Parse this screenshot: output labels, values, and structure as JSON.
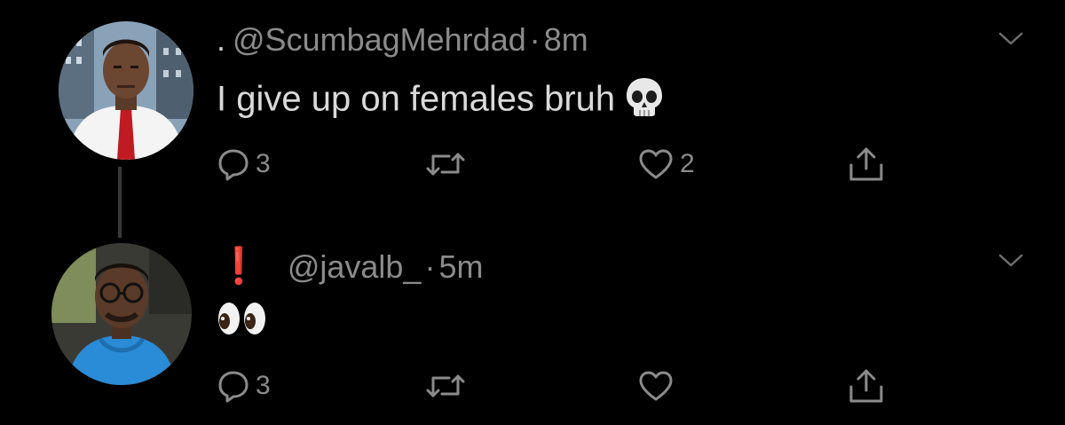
{
  "tweets": [
    {
      "prefix": ".",
      "handle": "@ScumbagMehrdad",
      "separator": "·",
      "time": "8m",
      "text": "I give up on females bruh",
      "emoji": "skull-emoji",
      "replies": "3",
      "retweets": "",
      "likes": "2",
      "avatar": "man-in-white-shirt-red-tie-avatar"
    },
    {
      "prefix": "❗",
      "handle": "@javalb_",
      "separator": "·",
      "time": "5m",
      "text": "",
      "emoji": "eyes-emoji",
      "replies": "3",
      "retweets": "",
      "likes": "",
      "avatar": "man-with-glasses-blue-hoodie-avatar"
    }
  ],
  "colors": {
    "background": "#000000",
    "text": "#dadada",
    "muted": "#8b8b8b",
    "accent_red": "#e0343a"
  },
  "icons": [
    "reply-icon",
    "retweet-icon",
    "heart-icon",
    "share-icon",
    "chevron-down-icon"
  ]
}
